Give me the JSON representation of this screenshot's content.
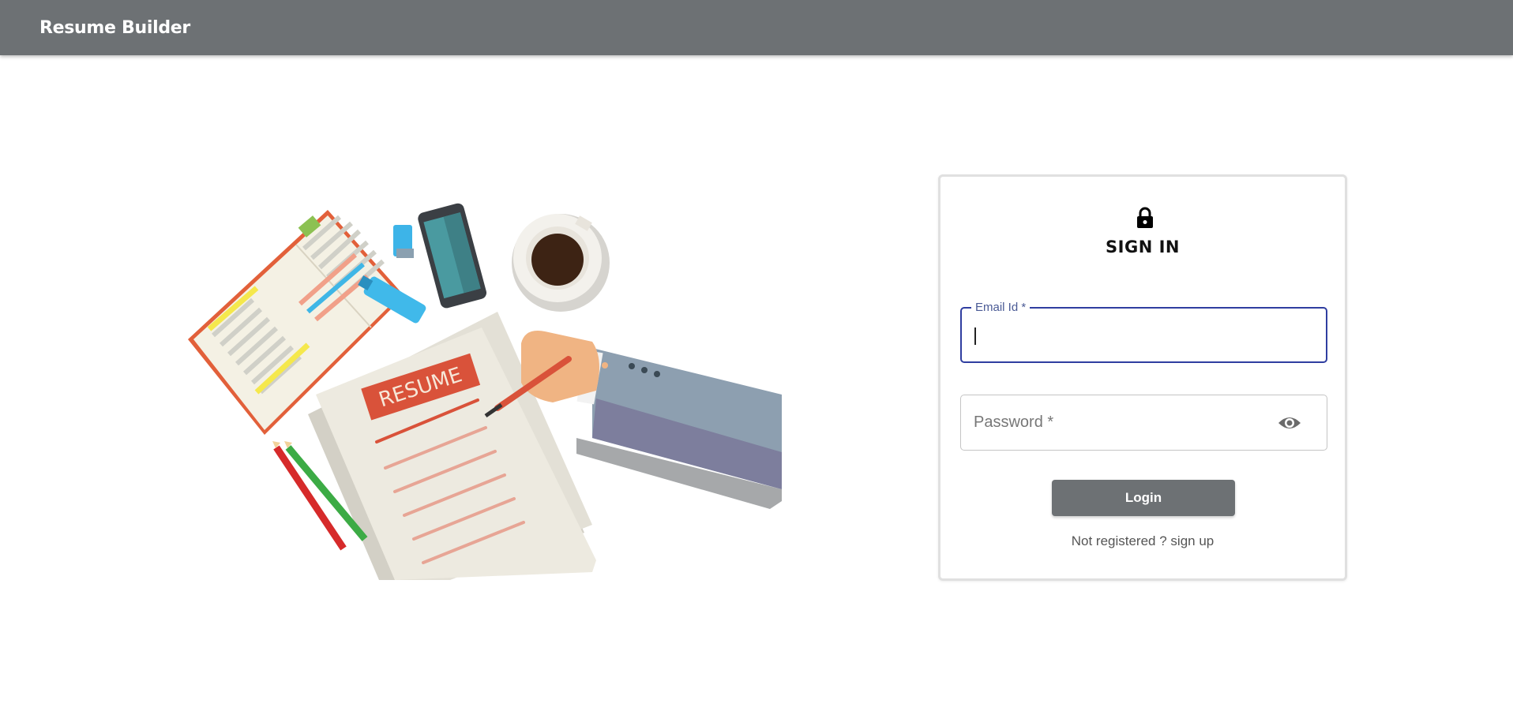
{
  "app": {
    "title": "Resume Builder"
  },
  "hero": {
    "resume_label": "RESUME",
    "icon": "resume-illustration"
  },
  "signin": {
    "title": "SIGN IN",
    "icon": "lock-icon",
    "email": {
      "label": "Email Id *",
      "value": ""
    },
    "password": {
      "placeholder": "Password *",
      "value": "",
      "icon": "eye-icon"
    },
    "login_label": "Login",
    "signup_prefix": "Not registered ? ",
    "signup_link": "sign up"
  },
  "colors": {
    "appbar": "#6d7174",
    "focus": "#2f3ea0",
    "button": "#6d7174"
  }
}
